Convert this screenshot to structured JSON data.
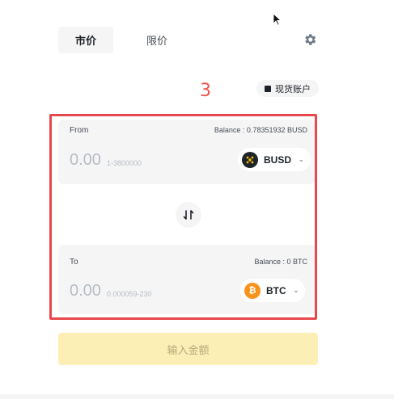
{
  "tabs": [
    {
      "label": "市价",
      "active": true
    },
    {
      "label": "限价",
      "active": false
    }
  ],
  "annotation": "3",
  "account_chip": {
    "label": "现货账户"
  },
  "from": {
    "label": "From",
    "balance": "Balance : 0.78351932 BUSD",
    "amount_placeholder": "0.00",
    "range": "1-3800000",
    "asset": "BUSD"
  },
  "to": {
    "label": "To",
    "balance": "Balance : 0 BTC",
    "amount_placeholder": "0.00",
    "range": "0.000059-230",
    "asset": "BTC",
    "asset_glyph": "₿"
  },
  "submit_label": "输入金额",
  "colors": {
    "accent_yellow": "#fcefb6",
    "annotation_red": "#e8474b",
    "btc_orange": "#f7931a",
    "panel_bg": "#f5f5f5"
  },
  "icons": [
    "cursor-icon",
    "gear-icon",
    "wallet-icon",
    "swap-icon",
    "busd-icon",
    "btc-icon",
    "chevron-down-icon"
  ]
}
